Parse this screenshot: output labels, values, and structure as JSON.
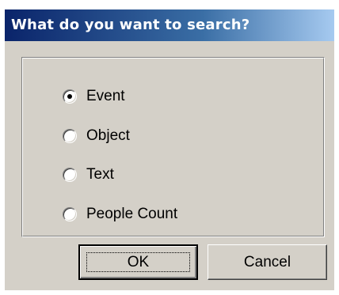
{
  "dialog": {
    "title": "What do you want to search?"
  },
  "options": [
    {
      "label": "Event",
      "selected": true
    },
    {
      "label": "Object",
      "selected": false
    },
    {
      "label": "Text",
      "selected": false
    },
    {
      "label": "People Count",
      "selected": false
    }
  ],
  "buttons": {
    "ok_label": "OK",
    "cancel_label": "Cancel"
  },
  "colors": {
    "titlebar_start": "#0a246a",
    "titlebar_end": "#a6caf0",
    "dialog_face": "#d4d0c8"
  }
}
